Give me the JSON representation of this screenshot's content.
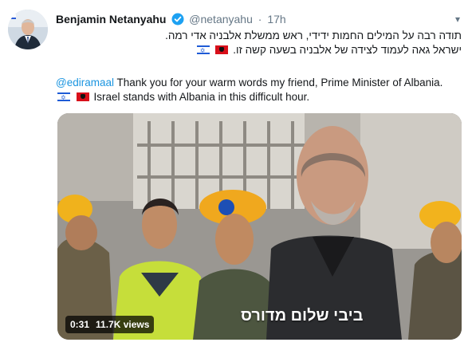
{
  "tweet": {
    "author_name": "Benjamin Netanyahu",
    "handle": "@netanyahu",
    "separator": "·",
    "time": "17h",
    "hebrew_line1": "תודה רבה על המילים החמות ידידי, ראש ממשלת אלבניה אדי רמה.",
    "hebrew_line2": "ישראל גאה לעמוד לצידה של אלבניה בשעה קשה זו.",
    "english_mention": "@ediramaal",
    "english_line1": " Thank you for your warm words my friend, Prime Minister of Albania.",
    "english_line2": "Israel stands with Albania in this difficult hour."
  },
  "video": {
    "subtitle": "ביבי שלום מדורס",
    "duration": "0:31",
    "views": "11.7K views"
  },
  "icons": {
    "verified": "verified-badge-icon",
    "caret": "chevron-down-icon",
    "flag_israel": "israel-flag-icon",
    "flag_albania": "albania-flag-icon"
  },
  "colors": {
    "link": "#1b95e0",
    "secondary_text": "#657786",
    "primary_text": "#14171a"
  }
}
